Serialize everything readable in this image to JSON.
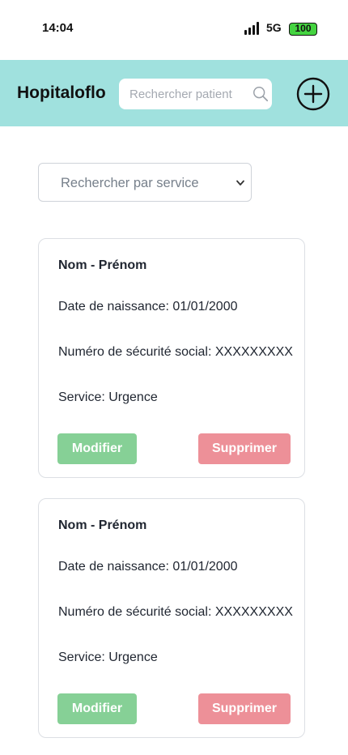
{
  "status_bar": {
    "time": "14:04",
    "network": "5G",
    "battery": "100"
  },
  "header": {
    "app_title": "Hopitaloflo",
    "search_placeholder": "Rechercher patient"
  },
  "filter": {
    "service_placeholder": "Rechercher par service"
  },
  "patients": [
    {
      "name": "Nom - Prénom",
      "birth_line": "Date de naissance: 01/01/2000",
      "ssn_line": "Numéro de sécurité social: XXXXXXXXX",
      "service_line": "Service: Urgence",
      "modify_label": "Modifier",
      "delete_label": "Supprimer"
    },
    {
      "name": "Nom - Prénom",
      "birth_line": "Date de naissance: 01/01/2000",
      "ssn_line": "Numéro de sécurité social: XXXXXXXXX",
      "service_line": "Service: Urgence",
      "modify_label": "Modifier",
      "delete_label": "Supprimer"
    }
  ],
  "colors": {
    "header_bg": "#a0e1de",
    "modify_button": "#86d096",
    "delete_button": "#ed9098",
    "battery": "#44d340"
  },
  "icons": {
    "search": "search-icon",
    "add": "plus-circle-icon",
    "dropdown": "chevron-down-icon",
    "signal": "signal-icon"
  }
}
